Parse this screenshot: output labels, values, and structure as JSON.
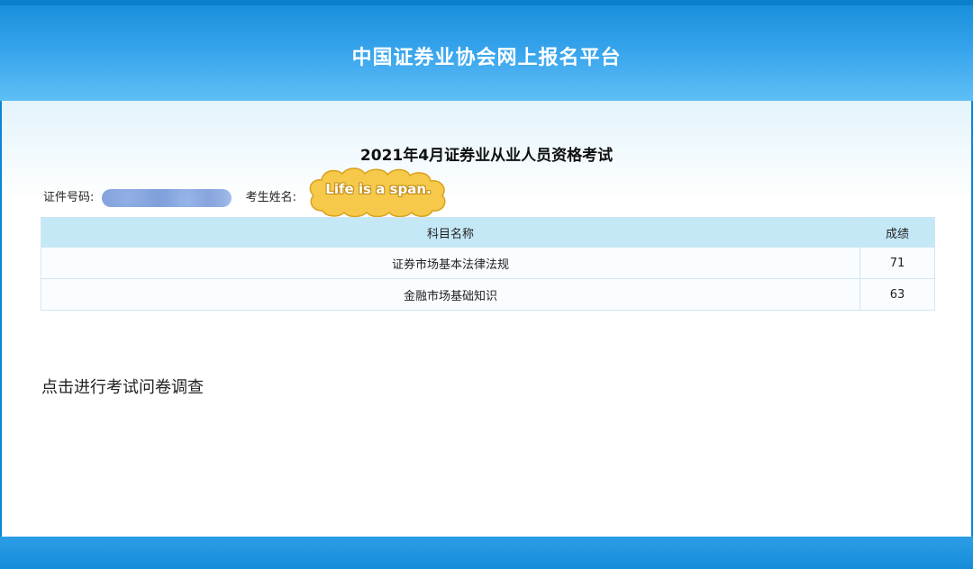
{
  "header": {
    "title": "中国证券业协会网上报名平台"
  },
  "exam": {
    "title": "2021年4月证券业从业人员资格考试"
  },
  "candidate": {
    "id_label": "证件号码:",
    "name_label": "考生姓名:"
  },
  "sticker": {
    "text": "Life is a span."
  },
  "scores": {
    "headers": {
      "subject": "科目名称",
      "score": "成绩"
    },
    "rows": [
      {
        "subject": "证券市场基本法律法规",
        "score": "71"
      },
      {
        "subject": "金融市场基础知识",
        "score": "63"
      }
    ]
  },
  "survey": {
    "link_label": "点击进行考试问卷调查"
  },
  "colors": {
    "header_blue": "#35a3ec",
    "table_header_bg": "#c5e8f7",
    "sticker_yellow": "#f7c94a"
  }
}
